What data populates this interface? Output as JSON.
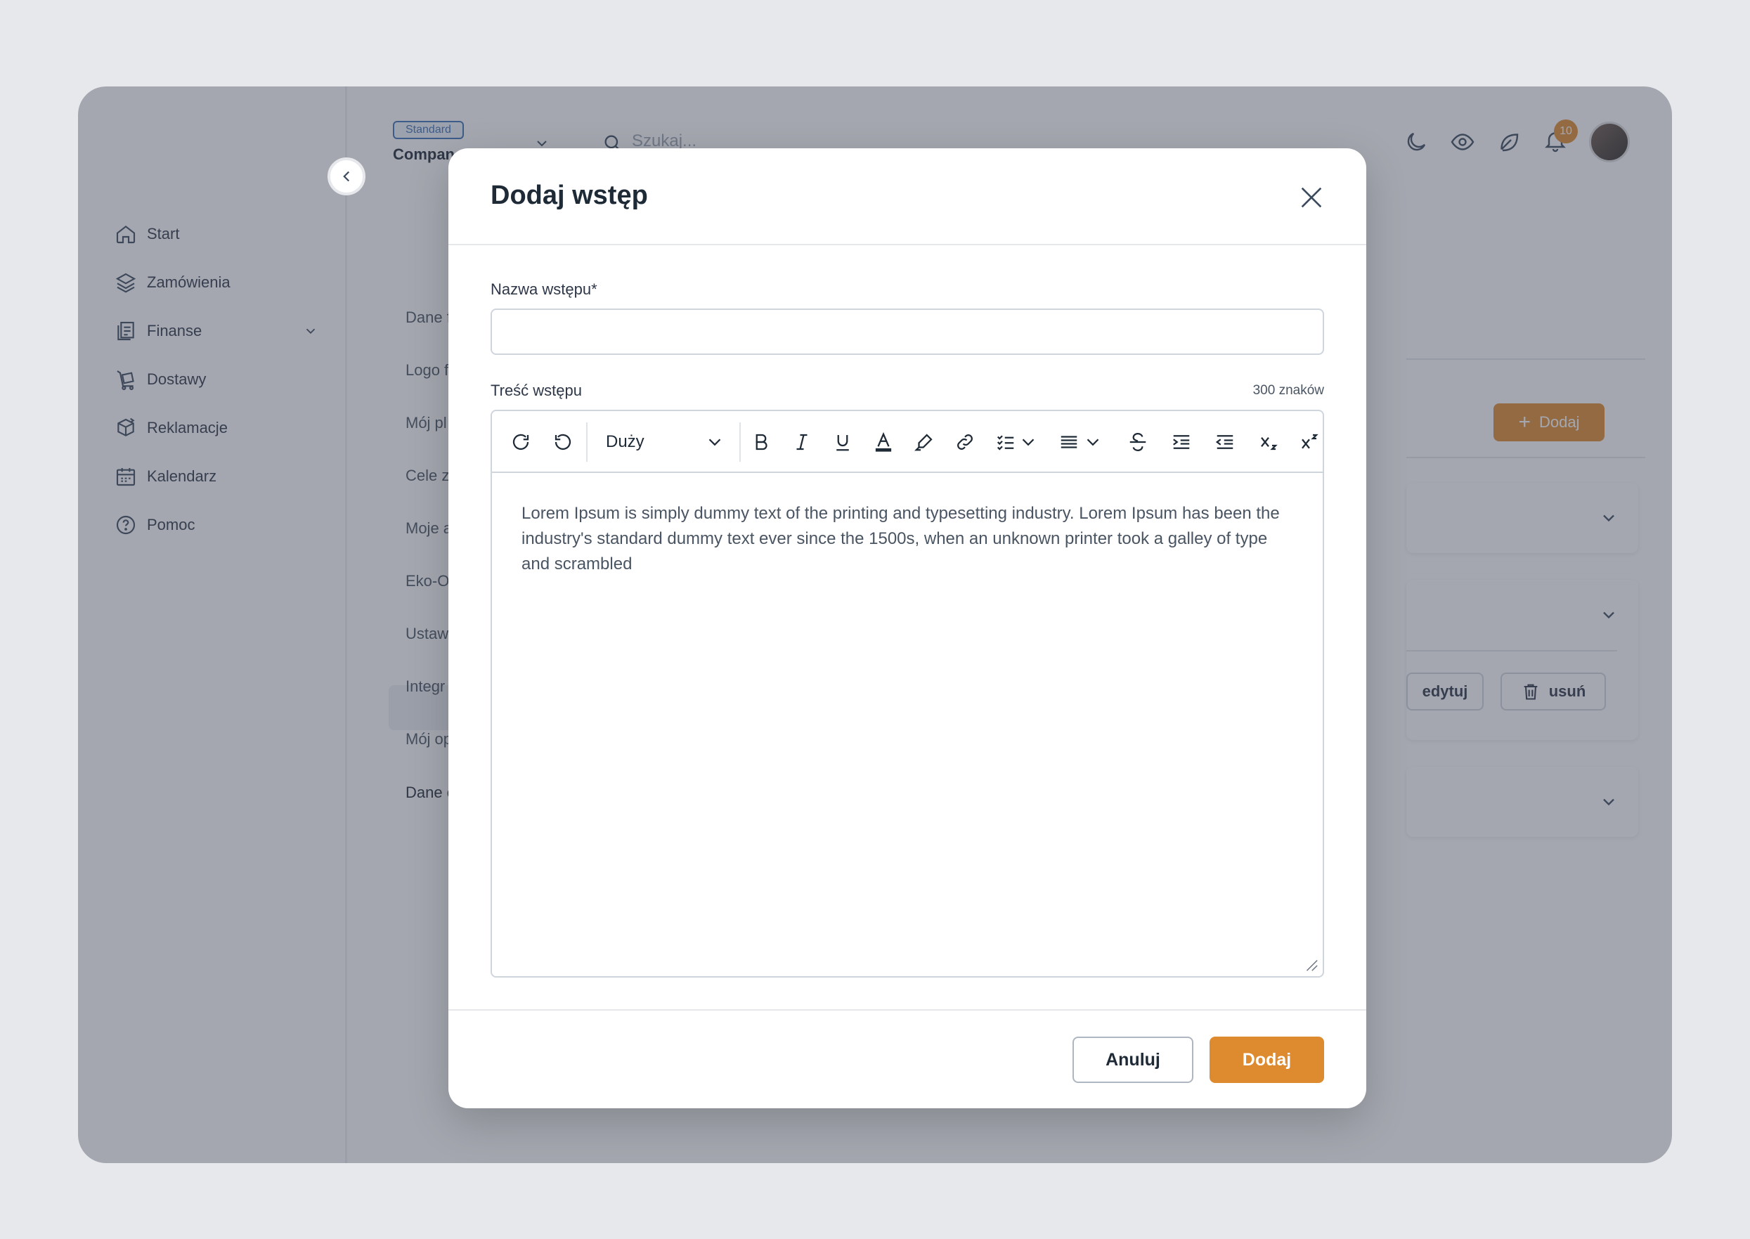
{
  "sidebar": {
    "items": [
      {
        "label": "Start",
        "icon": "home-icon"
      },
      {
        "label": "Zamówienia",
        "icon": "layers-icon"
      },
      {
        "label": "Finanse",
        "icon": "document-stack-icon"
      },
      {
        "label": "Dostawy",
        "icon": "cart-icon"
      },
      {
        "label": "Reklamacje",
        "icon": "box-return-icon"
      },
      {
        "label": "Kalendarz",
        "icon": "calendar-icon"
      },
      {
        "label": "Pomoc",
        "icon": "help-circle-icon"
      }
    ]
  },
  "company": {
    "badge": "Standard",
    "name": "Compan"
  },
  "topbar": {
    "search_placeholder": "Szukaj...",
    "notification_count": "10"
  },
  "settings_menu": {
    "items": [
      "Dane f",
      "Logo f",
      "Mój pl",
      "Cele z",
      "Moje a",
      "Eko-O",
      "Ustaw",
      "Integr",
      "Mój op",
      "Dane c"
    ]
  },
  "content": {
    "add_label": "Dodaj",
    "edit_label": "edytuj",
    "delete_label": "usuń"
  },
  "modal": {
    "title": "Dodaj wstęp",
    "name_label": "Nazwa wstępu*",
    "name_value": "",
    "content_label": "Treść wstępu",
    "char_count": "300 znaków",
    "font_size": "Duży",
    "body_text": "Lorem Ipsum is simply dummy text of the printing and typesetting industry. Lorem Ipsum has been the industry's standard dummy text ever since the 1500s, when an unknown printer took a galley of type and scrambled",
    "cancel_label": "Anuluj",
    "submit_label": "Dodaj"
  },
  "colors": {
    "accent": "#de8a2e",
    "badge": "#3b6fb6",
    "text": "#1f2a37"
  }
}
